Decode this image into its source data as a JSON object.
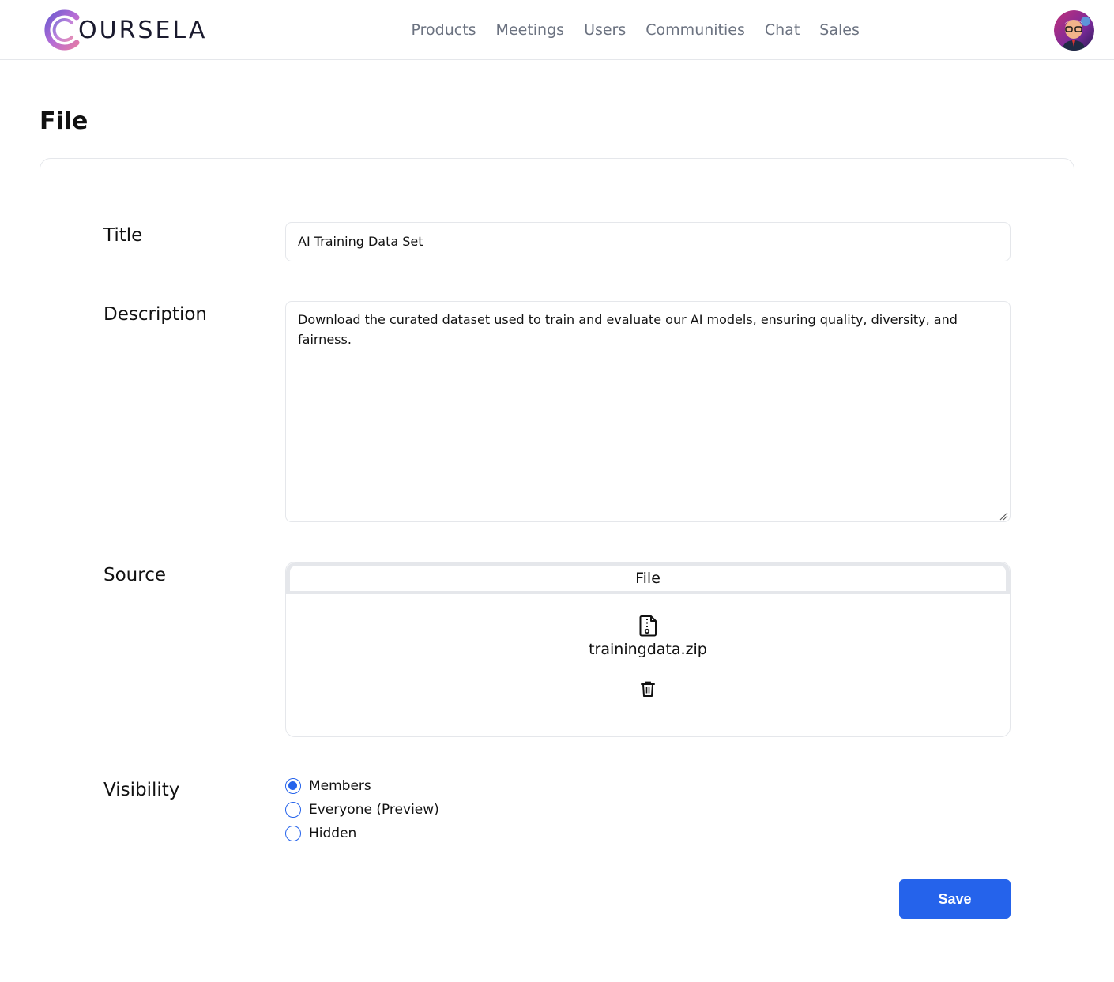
{
  "brand": {
    "logo_text": "OURSELA",
    "accent": "#2563eb"
  },
  "nav": [
    {
      "label": "Products"
    },
    {
      "label": "Meetings"
    },
    {
      "label": "Users"
    },
    {
      "label": "Communities"
    },
    {
      "label": "Chat"
    },
    {
      "label": "Sales"
    }
  ],
  "page": {
    "title": "File"
  },
  "form": {
    "title_label": "Title",
    "title_value": "AI Training Data Set",
    "description_label": "Description",
    "description_value": "Download the curated dataset used to train and evaluate our AI models, ensuring quality, diversity, and fairness.",
    "source_label": "Source",
    "source_tab": "File",
    "source_file_name": "trainingdata.zip",
    "visibility_label": "Visibility",
    "visibility_options": [
      {
        "label": "Members",
        "checked": true
      },
      {
        "label": "Everyone (Preview)",
        "checked": false
      },
      {
        "label": "Hidden",
        "checked": false
      }
    ],
    "save_label": "Save"
  }
}
